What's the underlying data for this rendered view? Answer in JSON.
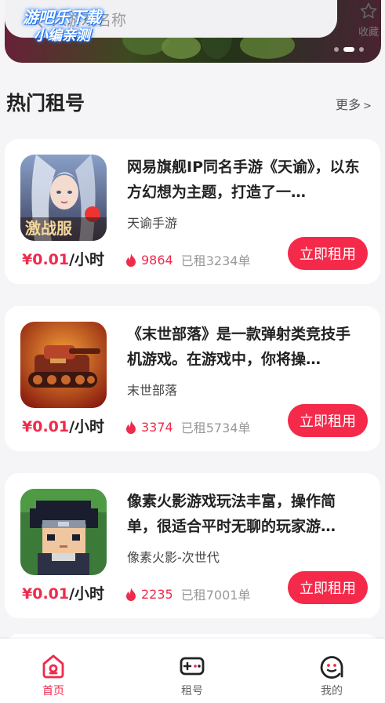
{
  "header": {
    "search_placeholder": "入游戏名称",
    "watermark_line1": "游吧乐下载",
    "watermark_line2": "小编亲测",
    "favorite_label": "收藏"
  },
  "section": {
    "title": "热门租号",
    "more_label": "更多",
    "more_chevron": ">"
  },
  "games": [
    {
      "desc": "网易旗舰IP同名手游《天谕》，以东方幻想为主题，打造了一…",
      "name": "天谕手游",
      "price": "¥0.01",
      "unit": "/小时",
      "heat": "9864",
      "rented": "已租3234单",
      "button": "立即租用",
      "thumb_text": "激战服",
      "icon": "tianyu-game-icon"
    },
    {
      "desc": "《末世部落》是一款弹射类竞技手机游戏。在游戏中，你将操…",
      "name": "末世部落",
      "price": "¥0.01",
      "unit": "/小时",
      "heat": "3374",
      "rented": "已租5734单",
      "button": "立即租用",
      "icon": "tank-game-icon"
    },
    {
      "desc": "像素火影游戏玩法丰富，操作简单，很适合平时无聊的玩家游…",
      "name": "像素火影-次世代",
      "price": "¥0.01",
      "unit": "/小时",
      "heat": "2235",
      "rented": "已租7001单",
      "button": "立即租用",
      "icon": "pixel-ninja-game-icon"
    }
  ],
  "bottom_nav": [
    {
      "label": "首页",
      "icon": "home-icon",
      "active": true
    },
    {
      "label": "租号",
      "icon": "gamepad-icon",
      "active": false
    },
    {
      "label": "我的",
      "icon": "profile-icon",
      "active": false
    }
  ],
  "colors": {
    "accent": "#ee2b4c",
    "button": "#f5294a",
    "background": "#f5f5f7"
  }
}
